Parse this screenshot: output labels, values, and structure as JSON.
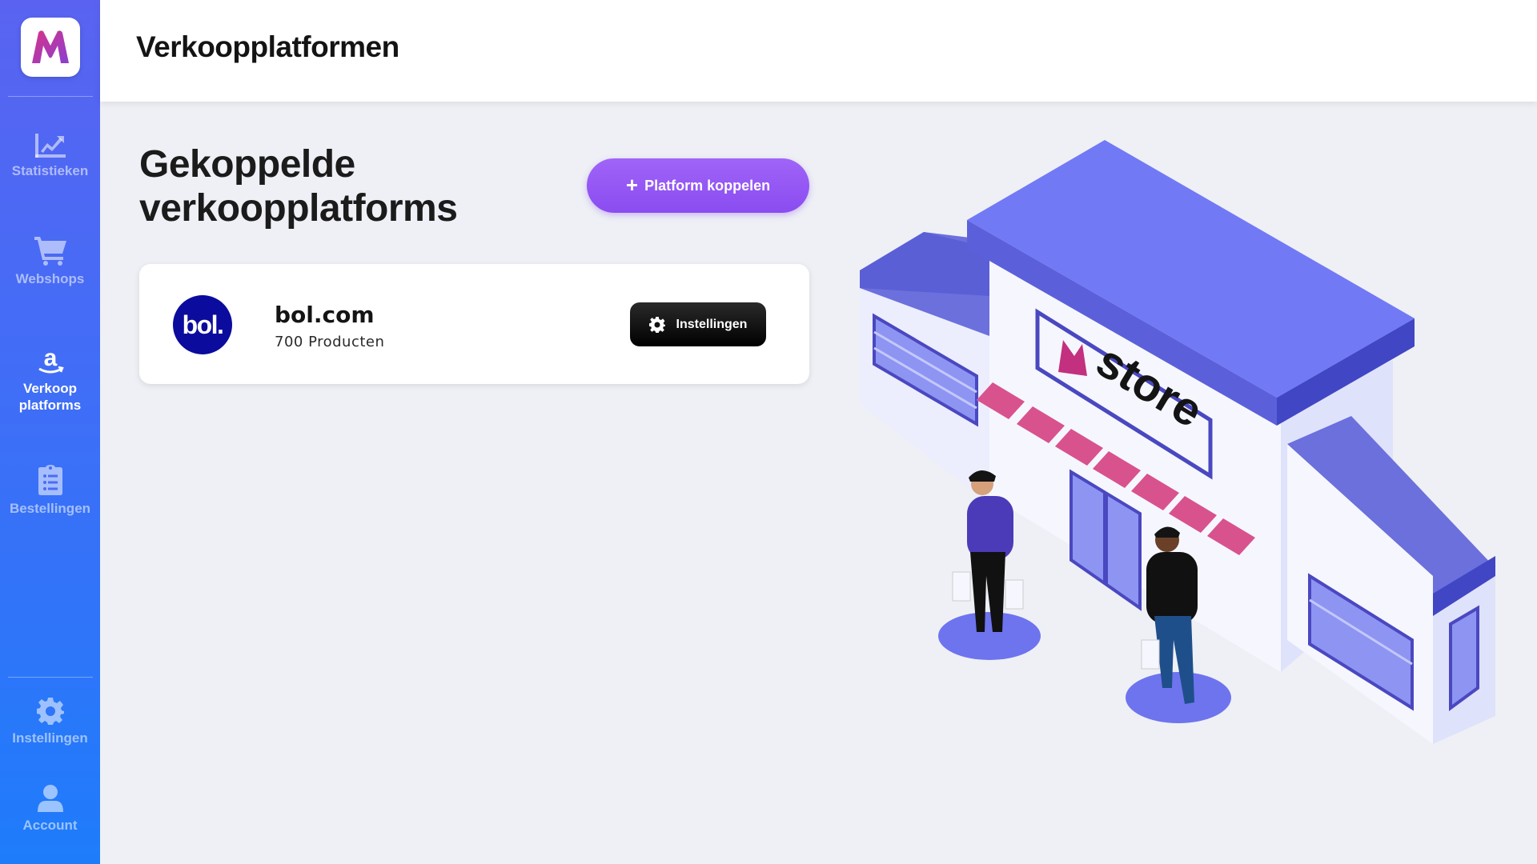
{
  "sidebar": {
    "items": [
      {
        "label": "Statistieken",
        "icon": "chart-line-icon",
        "active": false
      },
      {
        "label": "Webshops",
        "icon": "shopping-cart-icon",
        "active": false
      },
      {
        "label": "Verkoop platforms",
        "icon": "amazon-icon",
        "active": true
      },
      {
        "label": "Bestellingen",
        "icon": "clipboard-list-icon",
        "active": false
      }
    ],
    "bottom_items": [
      {
        "label": "Instellingen",
        "icon": "gear-icon"
      },
      {
        "label": "Account",
        "icon": "user-icon"
      }
    ]
  },
  "header": {
    "title": "Verkoopplatformen"
  },
  "main": {
    "section_title": "Gekoppelde verkoopplatforms",
    "connect_button": {
      "label": "Platform koppelen",
      "icon": "plus-icon"
    },
    "platforms": [
      {
        "logo_text": "bol.",
        "name": "bol.com",
        "count": "700 Producten",
        "settings_label": "Instellingen"
      }
    ]
  },
  "illustration": {
    "sign_text": "store"
  },
  "colors": {
    "sidebar_top": "#5a63f1",
    "sidebar_bottom": "#1e7cfb",
    "accent_purple": "#8a4cf0",
    "brand_pink": "#c2307f",
    "bol_blue": "#0b0b9e",
    "background": "#eef0f5"
  }
}
